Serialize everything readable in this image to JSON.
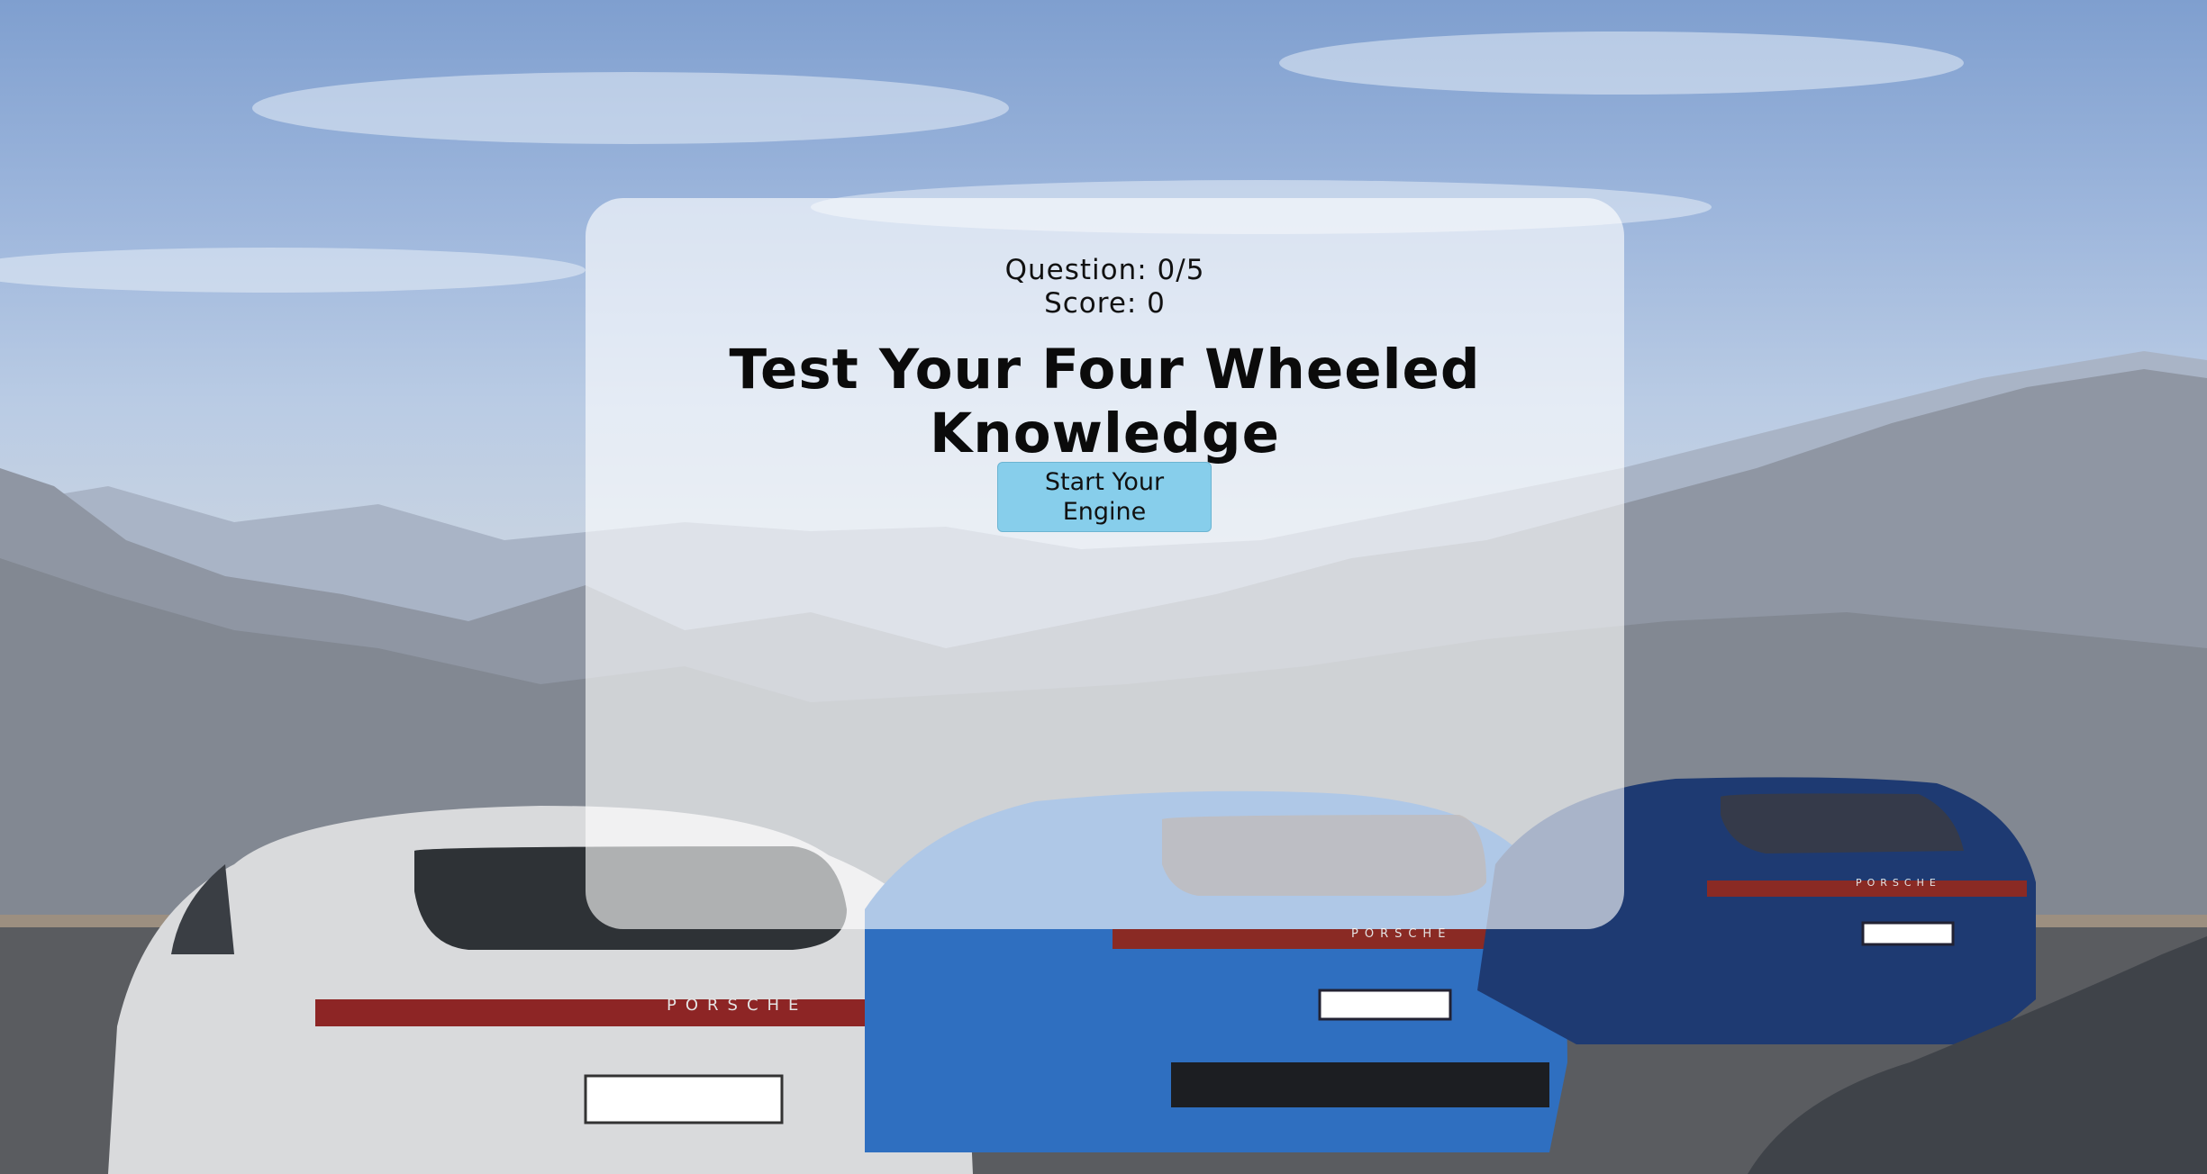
{
  "quiz": {
    "question_label": "Question: 0/5",
    "score_label": "Score: 0",
    "title": "Test Your Four Wheeled Knowledge",
    "start_button_label": "Start Your Engine"
  },
  "background": {
    "description_icon": "porsche-cars-mountain-image",
    "card_color": "#ffffff",
    "button_color": "#87ceeb",
    "brand_lettering": "PORSCHE"
  }
}
